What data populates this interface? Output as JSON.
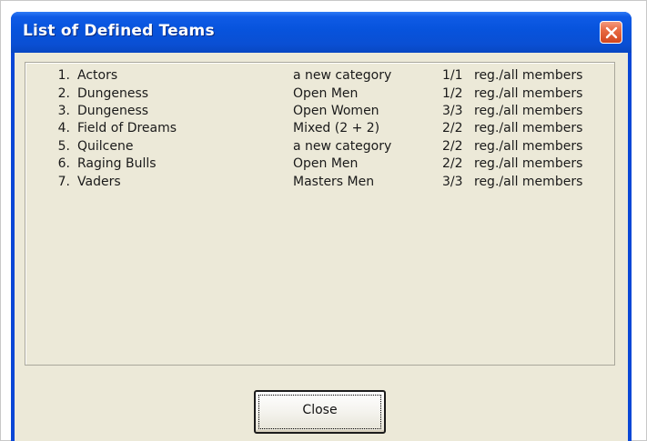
{
  "window": {
    "title": "List of Defined Teams"
  },
  "teams": [
    {
      "number": "1.",
      "name": "Actors",
      "category": "a new category",
      "registered": "1/1",
      "status": "reg./all members"
    },
    {
      "number": "2.",
      "name": "Dungeness",
      "category": "Open Men",
      "registered": "1/2",
      "status": "reg./all members"
    },
    {
      "number": "3.",
      "name": "Dungeness",
      "category": "Open Women",
      "registered": "3/3",
      "status": "reg./all members"
    },
    {
      "number": "4.",
      "name": "Field of Dreams",
      "category": "Mixed (2 + 2)",
      "registered": "2/2",
      "status": "reg./all members"
    },
    {
      "number": "5.",
      "name": "Quilcene",
      "category": "a new category",
      "registered": "2/2",
      "status": "reg./all members"
    },
    {
      "number": "6.",
      "name": "Raging Bulls",
      "category": "Open Men",
      "registered": "2/2",
      "status": "reg./all members"
    },
    {
      "number": "7.",
      "name": "Vaders",
      "category": "Masters Men",
      "registered": "3/3",
      "status": "reg./all members"
    }
  ],
  "buttons": {
    "close_label": "Close"
  },
  "icons": {
    "title_close": "close-icon"
  }
}
